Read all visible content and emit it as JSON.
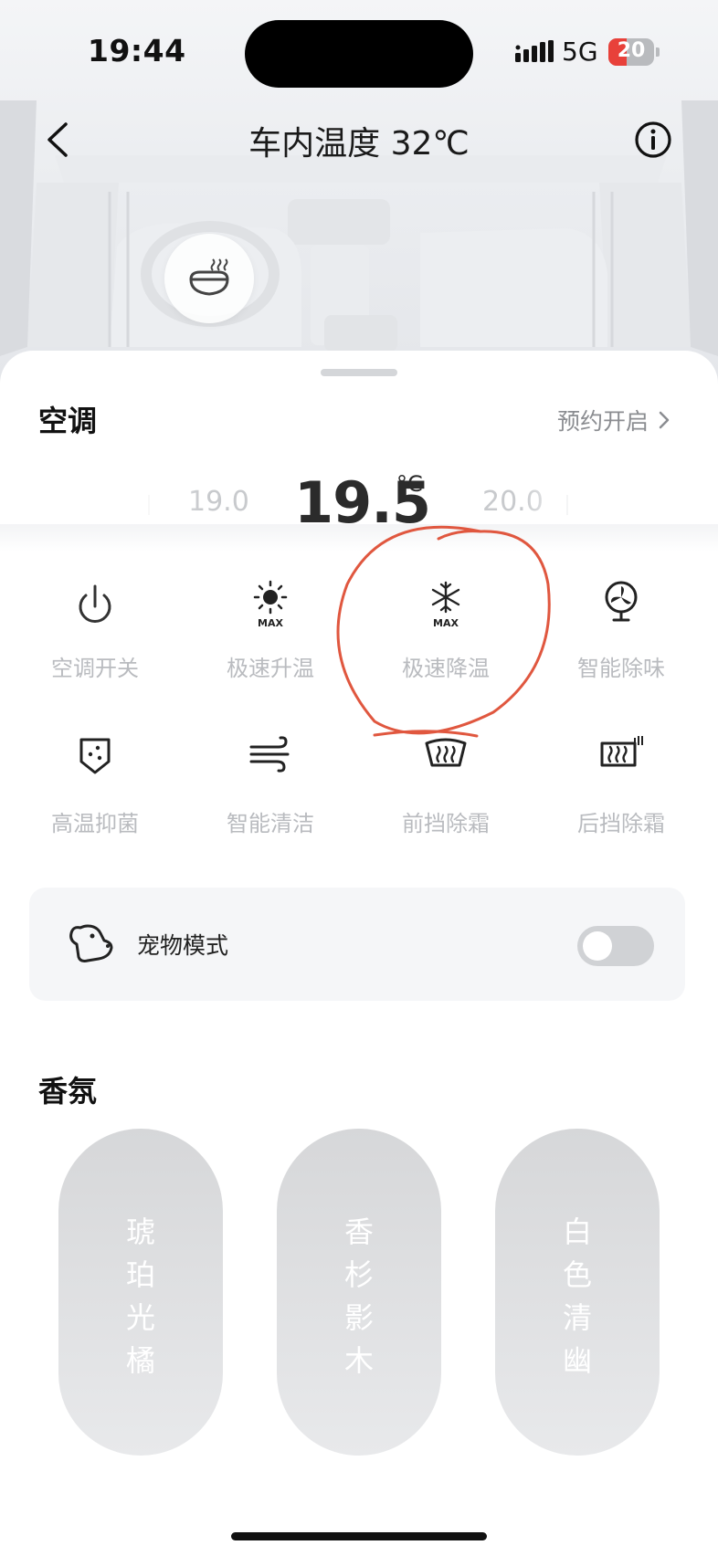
{
  "status_bar": {
    "time": "19:44",
    "network": "5G",
    "battery_level": "20",
    "battery_color": "#e8413a"
  },
  "nav": {
    "title": "车内温度 32℃",
    "back_icon": "chevron-left-icon",
    "info_icon": "info-icon"
  },
  "hero": {
    "seat_heat_icon": "seat-heat-icon"
  },
  "climate": {
    "section_title": "空调",
    "schedule_label": "预约开启",
    "temp_prev": "19.0",
    "temp_current": "19.5",
    "temp_unit": "°C",
    "temp_next": "20.0"
  },
  "functions": [
    {
      "label": "空调开关",
      "icon": "power-icon"
    },
    {
      "label": "极速升温",
      "icon": "sun-max-icon"
    },
    {
      "label": "极速降温",
      "icon": "snowflake-max-icon"
    },
    {
      "label": "智能除味",
      "icon": "fan-icon"
    },
    {
      "label": "高温抑菌",
      "icon": "shield-dots-icon"
    },
    {
      "label": "智能清洁",
      "icon": "wind-icon"
    },
    {
      "label": "前挡除霜",
      "icon": "front-defrost-icon"
    },
    {
      "label": "后挡除霜",
      "icon": "rear-defrost-icon"
    }
  ],
  "pet_mode": {
    "label": "宠物模式",
    "icon": "dog-icon",
    "enabled": false
  },
  "fragrance": {
    "section_title": "香氛",
    "items": [
      {
        "label": "琥珀光橘"
      },
      {
        "label": "香杉影木"
      },
      {
        "label": "白色清幽"
      }
    ]
  },
  "colors": {
    "annotation": "#e0573f",
    "label_gray": "#b9bbbf",
    "toggle_off": "#d0d2d5"
  }
}
